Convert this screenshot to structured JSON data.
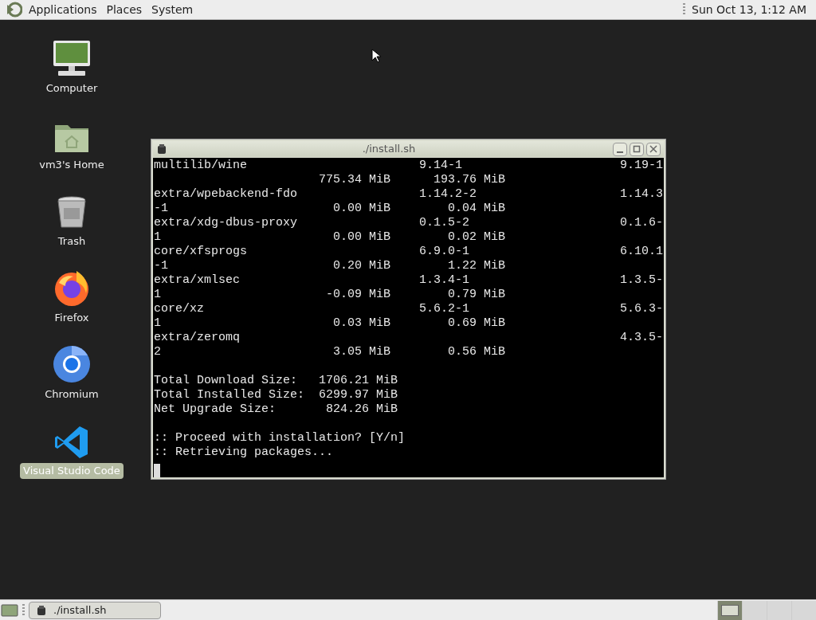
{
  "top_panel": {
    "menus": [
      "Applications",
      "Places",
      "System"
    ],
    "clock": "Sun Oct 13, 1:12 AM"
  },
  "desktop_icons": [
    {
      "kind": "computer",
      "label": "Computer",
      "selected": false
    },
    {
      "kind": "home",
      "label": "vm3's Home",
      "selected": false
    },
    {
      "kind": "trash",
      "label": "Trash",
      "selected": false
    },
    {
      "kind": "firefox",
      "label": "Firefox",
      "selected": false
    },
    {
      "kind": "chromium",
      "label": "Chromium",
      "selected": false
    },
    {
      "kind": "vscode",
      "label": "Visual Studio Code",
      "selected": true
    }
  ],
  "terminal": {
    "title": "./install.sh",
    "package_lines": [
      "multilib/wine                        9.14-1                      9.19-1",
      "                       775.34 MiB      193.76 MiB",
      "extra/wpebackend-fdo                 1.14.2-2                    1.14.3",
      "-1                       0.00 MiB        0.04 MiB",
      "extra/xdg-dbus-proxy                 0.1.5-2                     0.1.6-",
      "1                        0.00 MiB        0.02 MiB",
      "core/xfsprogs                        6.9.0-1                     6.10.1",
      "-1                       0.20 MiB        1.22 MiB",
      "extra/xmlsec                         1.3.4-1                     1.3.5-",
      "1                       -0.09 MiB        0.79 MiB",
      "core/xz                              5.6.2-1                     5.6.3-",
      "1                        0.03 MiB        0.69 MiB",
      "extra/zeromq                                                     4.3.5-",
      "2                        3.05 MiB        0.56 MiB"
    ],
    "summary_lines": [
      "Total Download Size:   1706.21 MiB",
      "Total Installed Size:  6299.97 MiB",
      "Net Upgrade Size:       824.26 MiB"
    ],
    "prompt_lines": [
      ":: Proceed with installation? [Y/n]",
      ":: Retrieving packages..."
    ]
  },
  "taskbar": {
    "windows": [
      {
        "label": "./install.sh",
        "selected": false
      }
    ],
    "workspaces": [
      {
        "selected": true
      },
      {
        "selected": false
      },
      {
        "selected": false
      },
      {
        "selected": false
      }
    ]
  }
}
